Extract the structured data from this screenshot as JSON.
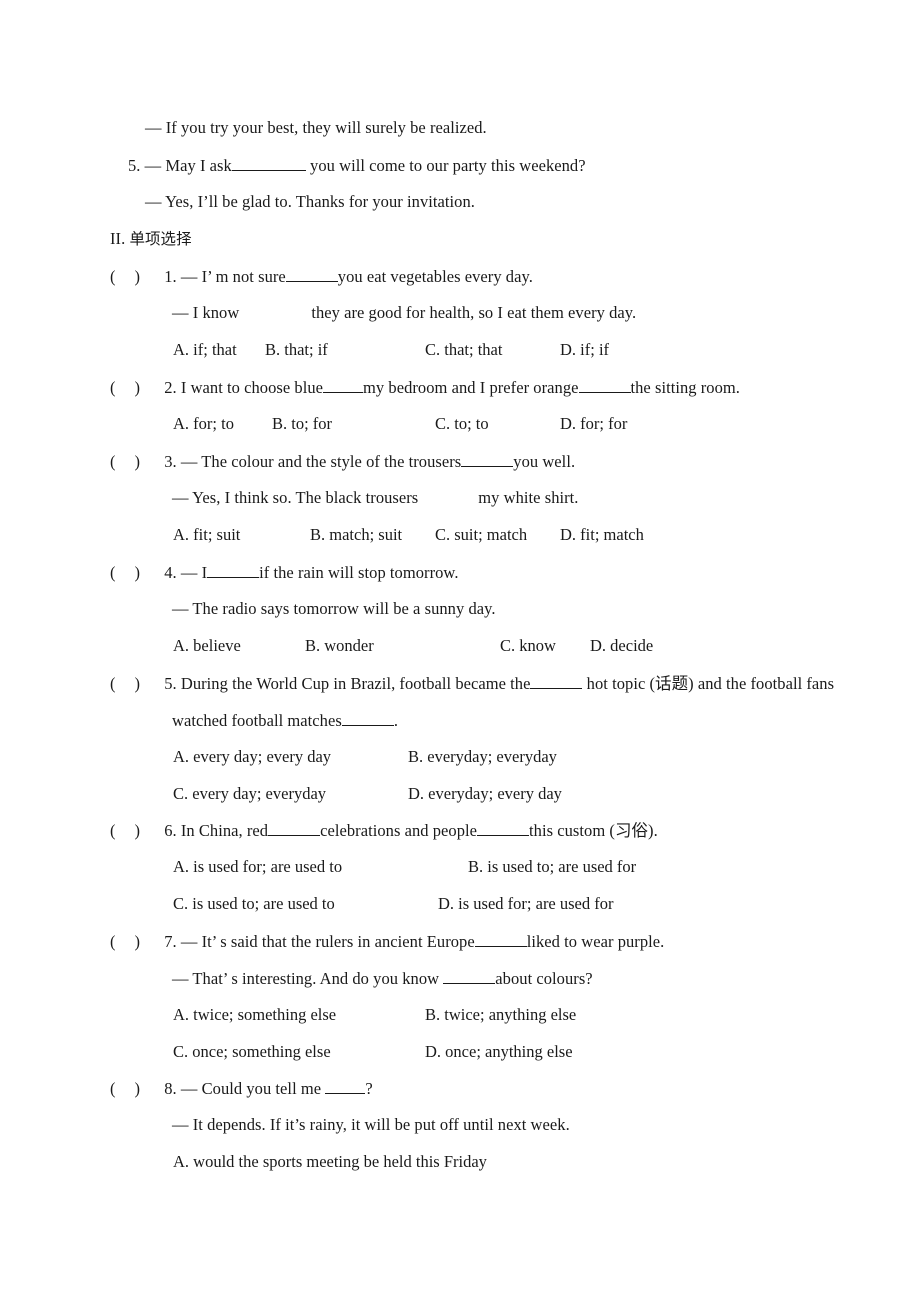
{
  "document": {
    "carryover": {
      "reply_prev": "— If you try your best, they will surely be realized.",
      "q5_number": "5.",
      "q5_stem_a": "— May I ask",
      "q5_stem_b": "you will come to our party this weekend?",
      "q5_reply": "— Yes, I’ll be glad to. Thanks for your invitation."
    },
    "section": {
      "label": "II.",
      "title": "单项选择"
    },
    "bracket": {
      "open": "(",
      "close": ")"
    },
    "questions": [
      {
        "number": "1.",
        "stem_a": "— I’ m not sure",
        "stem_b": "you eat vegetables every day.",
        "reply_a": "— I know",
        "reply_b": "they are good for health, so I eat them every day.",
        "options": [
          "A. if; that",
          "B. that; if",
          "C. that; that",
          "D. if; if"
        ]
      },
      {
        "number": "2.",
        "stem_a": "I want to choose blue",
        "stem_b": "my bedroom and I prefer orange",
        "stem_c": "the sitting room.",
        "options": [
          "A. for; to",
          "B. to; for",
          "C. to; to",
          "D. for; for"
        ]
      },
      {
        "number": "3.",
        "stem_a": "— The colour and the style of the trousers",
        "stem_b": "you well.",
        "reply_a": "— Yes, I think so. The black trousers",
        "reply_b": "my white shirt.",
        "options": [
          "A. fit; suit",
          "B. match; suit",
          "C. suit; match",
          "D. fit; match"
        ]
      },
      {
        "number": "4.",
        "stem_a": "— I",
        "stem_b": "if the rain will stop tomorrow.",
        "reply_a": "— The radio says tomorrow will be a sunny day.",
        "options": [
          "A. believe",
          "B. wonder",
          "C. know",
          "D. decide"
        ]
      },
      {
        "number": "5.",
        "stem_a": "During the World Cup in Brazil, football became the",
        "stem_b": "hot topic (话题) and the football fans",
        "stem_cont_a": "watched football matches",
        "stem_cont_b": ".",
        "options": [
          "A. every day; every day",
          "B. everyday; everyday",
          "C. every day; everyday",
          "D. everyday; every day"
        ]
      },
      {
        "number": "6.",
        "stem_a": "In China, red",
        "stem_b": "celebrations and people",
        "stem_c": "this custom (习俗).",
        "options": [
          "A. is used for; are used to",
          "B. is used to; are used for",
          "C. is used to; are used to",
          "D. is used for; are used for"
        ]
      },
      {
        "number": "7.",
        "stem_a": "— It’ s said that the rulers in ancient Europe",
        "stem_b": "liked to wear purple.",
        "reply_a": "— That’ s interesting. And do you know",
        "reply_b": "about colours?",
        "options": [
          "A. twice; something else",
          "B. twice; anything else",
          "C. once; something else",
          "D. once; anything else"
        ]
      },
      {
        "number": "8.",
        "stem_a": "— Could you tell me",
        "stem_b": "?",
        "reply_a": "— It depends. If it’s rainy, it will be put off until next week.",
        "options": [
          "A. would the sports meeting be held this Friday"
        ]
      }
    ]
  }
}
